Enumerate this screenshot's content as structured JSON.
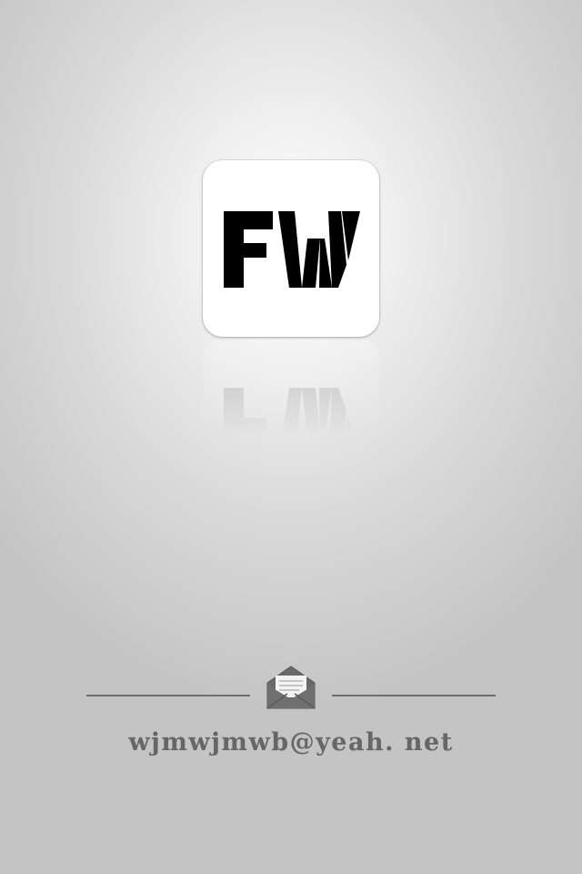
{
  "app": {
    "logo_text": "FW",
    "icon_name": "fw-logo-icon"
  },
  "contact": {
    "icon_name": "mail-icon",
    "email": "wjmwjmwb@yeah. net"
  }
}
